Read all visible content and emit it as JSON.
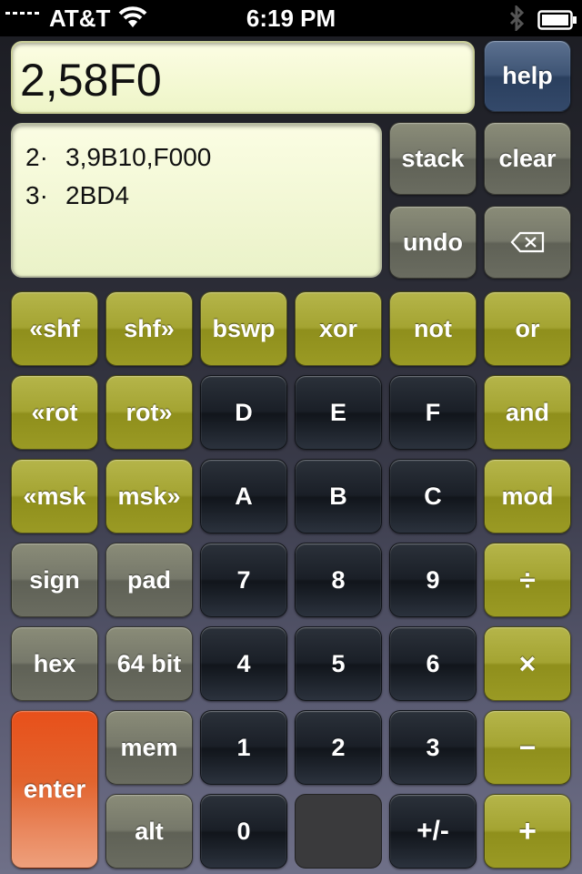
{
  "status_bar": {
    "carrier": "AT&T",
    "time": "6:19 PM",
    "wifi_icon": "wifi-icon",
    "bluetooth_icon": "bluetooth-icon",
    "battery_icon": "battery-icon"
  },
  "display": {
    "value": "2,58F0"
  },
  "stack": [
    {
      "level": "2·",
      "value": "3,9B10,F000"
    },
    {
      "level": "3·",
      "value": "2BD4"
    }
  ],
  "keys": {
    "help": "help",
    "stack": "stack",
    "clear": "clear",
    "undo": "undo",
    "backspace_icon": "backspace-icon",
    "shl": "«shf",
    "shr": "shf»",
    "bswp": "bswp",
    "xor": "xor",
    "not": "not",
    "or": "or",
    "rotl": "«rot",
    "rotr": "rot»",
    "d": "D",
    "e": "E",
    "f": "F",
    "and": "and",
    "mskl": "«msk",
    "mskr": "msk»",
    "a": "A",
    "b": "B",
    "c": "C",
    "mod": "mod",
    "sign": "sign",
    "pad": "pad",
    "n7": "7",
    "n8": "8",
    "n9": "9",
    "divide": "÷",
    "hex": "hex",
    "bits": "64 bit",
    "n4": "4",
    "n5": "5",
    "n6": "6",
    "multiply": "×",
    "enter": "enter",
    "mem": "mem",
    "n1": "1",
    "n2": "2",
    "n3": "3",
    "minus": "−",
    "alt": "alt",
    "n0": "0",
    "plusminus": "+/-",
    "plus": "+"
  },
  "colors": {
    "function_key": "#a4a432",
    "mode_key": "#76786a",
    "digit_key": "#1a1f27",
    "help_key": "#3e5474",
    "enter_key": "#e2642e",
    "display_bg": "#f2f7d2"
  }
}
